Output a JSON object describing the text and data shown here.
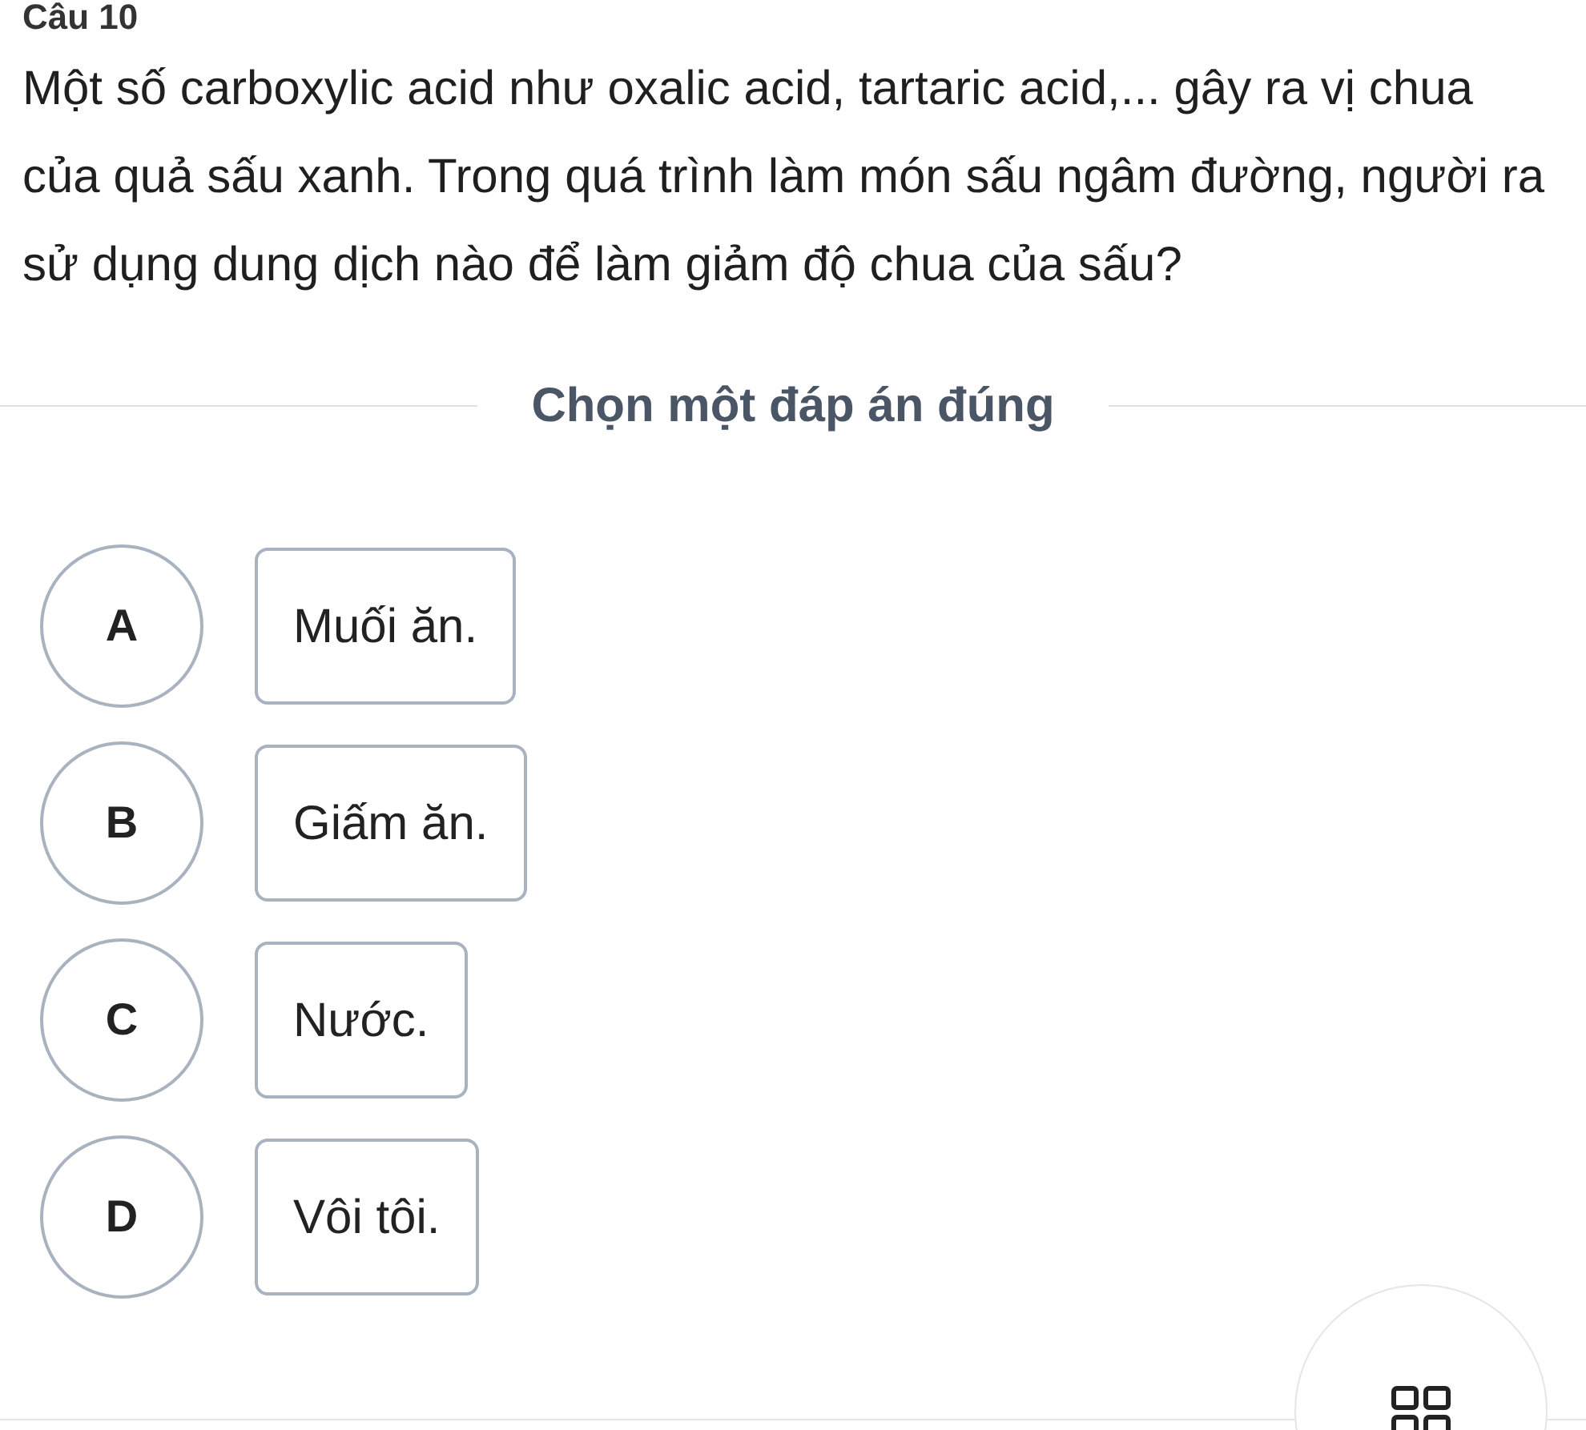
{
  "question_title": "Câu 10",
  "question": "Một số carboxylic acid như oxalic acid, tartaric acid,... gây ra vị chua của quả sấu xanh. Trong quá trình làm món sấu ngâm đường, người ra sử dụng dung dịch nào để làm giảm độ chua của sấu?",
  "instruction": "Chọn một đáp án đúng",
  "options": [
    {
      "letter": "A",
      "text": "Muối ăn.",
      "selected": false
    },
    {
      "letter": "B",
      "text": "Giấm ăn.",
      "selected": false
    },
    {
      "letter": "C",
      "text": "Nước.",
      "selected": false
    },
    {
      "letter": "D",
      "text": "Vôi tôi.",
      "selected": false
    }
  ]
}
